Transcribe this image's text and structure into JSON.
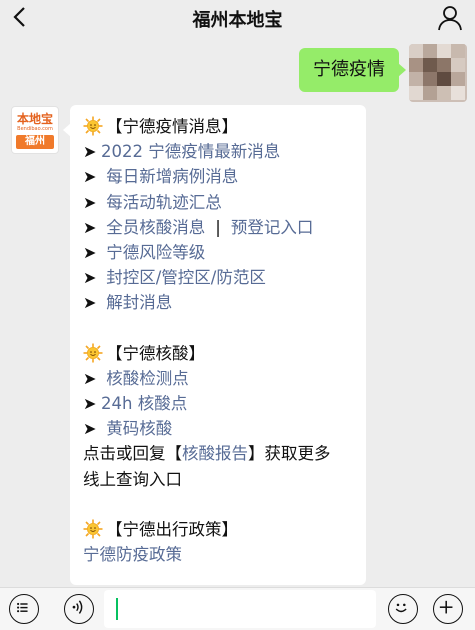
{
  "header": {
    "title": "福州本地宝",
    "back_icon": "chevron-left-icon",
    "profile_icon": "person-icon"
  },
  "outgoing": {
    "text": "宁德疫情"
  },
  "bot": {
    "avatar_brand": "本地宝",
    "avatar_url": "Bendibao.com",
    "avatar_city": "福州"
  },
  "message": {
    "sections": [
      {
        "heading": "【宁德疫情消息】",
        "items": [
          {
            "arrow": "➤",
            "text": "2022 宁德疫情最新消息"
          },
          {
            "arrow": "➤",
            "text": "每日新增病例消息"
          },
          {
            "arrow": "➤",
            "text": "每活动轨迹汇总"
          },
          {
            "arrow": "➤",
            "text": "全员核酸消息",
            "separator": "|",
            "text2": "预登记入口"
          },
          {
            "arrow": "➤",
            "text": "宁德风险等级"
          },
          {
            "arrow": "➤",
            "text": "封控区/管控区/防范区"
          },
          {
            "arrow": "➤",
            "text": "解封消息"
          }
        ]
      },
      {
        "heading": "【宁德核酸】",
        "items": [
          {
            "arrow": "➤",
            "text": "核酸检测点"
          },
          {
            "arrow": "➤",
            "text": "24h 核酸点"
          },
          {
            "arrow": "➤",
            "text": "黄码核酸"
          }
        ],
        "note_prefix": "点击或回复【",
        "note_link": "核酸报告",
        "note_suffix": "】获取更多",
        "note_line2": "线上查询入口"
      },
      {
        "heading": "【宁德出行政策】",
        "items": [
          {
            "text": "宁德防疫政策"
          }
        ]
      }
    ]
  },
  "input_bar": {
    "menu_icon": "menu-list-icon",
    "voice_icon": "voice-icon",
    "emoji_icon": "emoji-icon",
    "plus_icon": "plus-icon",
    "value": ""
  },
  "colors": {
    "background": "#ededed",
    "outgoing_bubble": "#95ec69",
    "link": "#576b95",
    "brand_orange": "#f07a2b",
    "caret": "#07c160"
  }
}
